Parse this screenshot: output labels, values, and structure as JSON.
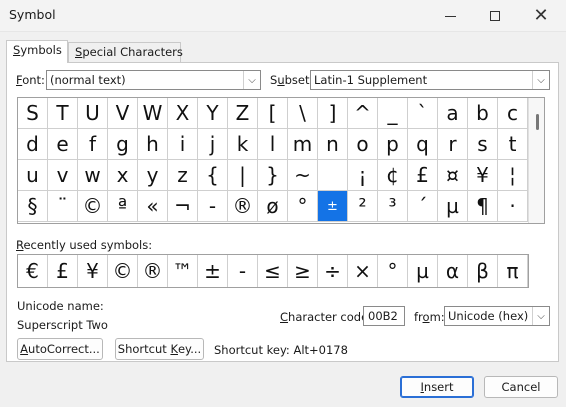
{
  "window": {
    "title": "Symbol"
  },
  "tabs": [
    {
      "label_ul": "S",
      "label_rest": "ymbols",
      "active": true
    },
    {
      "label_ul": "S",
      "label_pre": "",
      "label_rest": "pecial Characters",
      "active": false
    }
  ],
  "font": {
    "label_ul": "F",
    "label_rest": "ont:",
    "value": "(normal text)"
  },
  "subset": {
    "label_pre": "S",
    "label_ul": "u",
    "label_rest": "bset:",
    "value": "Latin-1 Supplement"
  },
  "grid": [
    [
      "S",
      "T",
      "U",
      "V",
      "W",
      "X",
      "Y",
      "Z",
      "[",
      "\\",
      "]",
      "^",
      "_",
      "`",
      "a",
      "b",
      "c"
    ],
    [
      "d",
      "e",
      "f",
      "g",
      "h",
      "i",
      "j",
      "k",
      "l",
      "m",
      "n",
      "o",
      "p",
      "q",
      "r",
      "s",
      "t"
    ],
    [
      "u",
      "v",
      "w",
      "x",
      "y",
      "z",
      "{",
      "|",
      "}",
      "~",
      " ",
      "¡",
      "¢",
      "£",
      "¤",
      "¥",
      "¦"
    ],
    [
      "§",
      "¨",
      "©",
      "ª",
      "«",
      "¬",
      "-",
      "®",
      "ø",
      "°",
      "±",
      "²",
      "³",
      "´",
      "µ",
      "¶",
      "·"
    ]
  ],
  "selected": {
    "row": 3,
    "col": 10
  },
  "recent": {
    "label_ul": "R",
    "label_rest": "ecently used symbols:",
    "symbols": [
      "€",
      "£",
      "¥",
      "©",
      "®",
      "™",
      "±",
      "-",
      "≤",
      "≥",
      "÷",
      "×",
      "°",
      "µ",
      "α",
      "β",
      "π"
    ]
  },
  "unicode_name": {
    "label": "Unicode name:",
    "value": "Superscript Two"
  },
  "char_code": {
    "label_ul": "C",
    "label_rest": "haracter code:",
    "value": "00B2"
  },
  "from": {
    "label_pre": "fr",
    "label_ul": "o",
    "label_rest": "m:",
    "value": "Unicode (hex)"
  },
  "buttons": {
    "autocorrect": {
      "label_ul": "A",
      "label_rest": "utoCorrect..."
    },
    "shortcut_key": {
      "label_pre": "Shortcut ",
      "label_ul": "K",
      "label_rest": "ey..."
    },
    "insert": {
      "label_ul": "I",
      "label_rest": "nsert"
    },
    "cancel": "Cancel"
  },
  "shortcut_text": "Shortcut key: Alt+0178"
}
